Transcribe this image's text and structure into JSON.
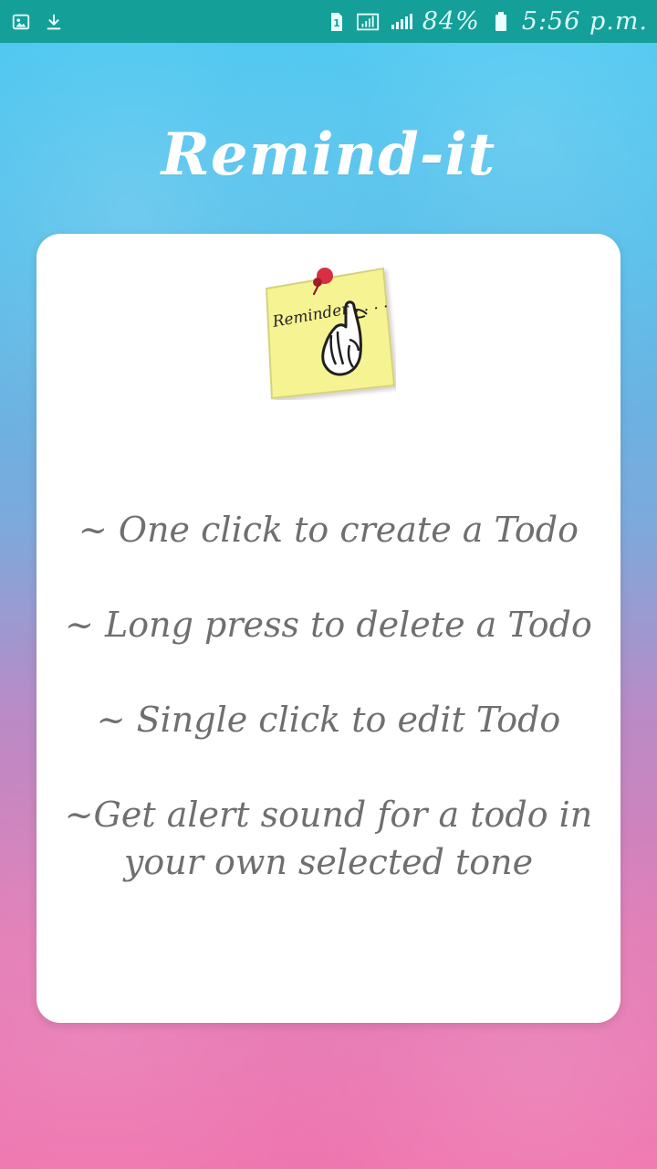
{
  "status_bar": {
    "battery": "84%",
    "time": "5:56 p.m.",
    "icons": {
      "gallery": "image-icon",
      "download": "download-icon",
      "sim": "sim-1-icon",
      "signal_1": "signal-icon",
      "signal_2": "signal-icon",
      "battery": "battery-icon"
    }
  },
  "header": {
    "title": "Remind-it"
  },
  "card": {
    "image_label": "Reminder . . . .",
    "tips": [
      "~ One click to create a Todo",
      "~ Long press to delete a Todo",
      "~ Single click to edit Todo",
      "~Get alert sound for a todo in your own selected tone"
    ]
  },
  "colors": {
    "status_bar": "#149f98",
    "card": "#ffffff",
    "title": "#ffffff",
    "tip_text": "#6f6f6f"
  }
}
